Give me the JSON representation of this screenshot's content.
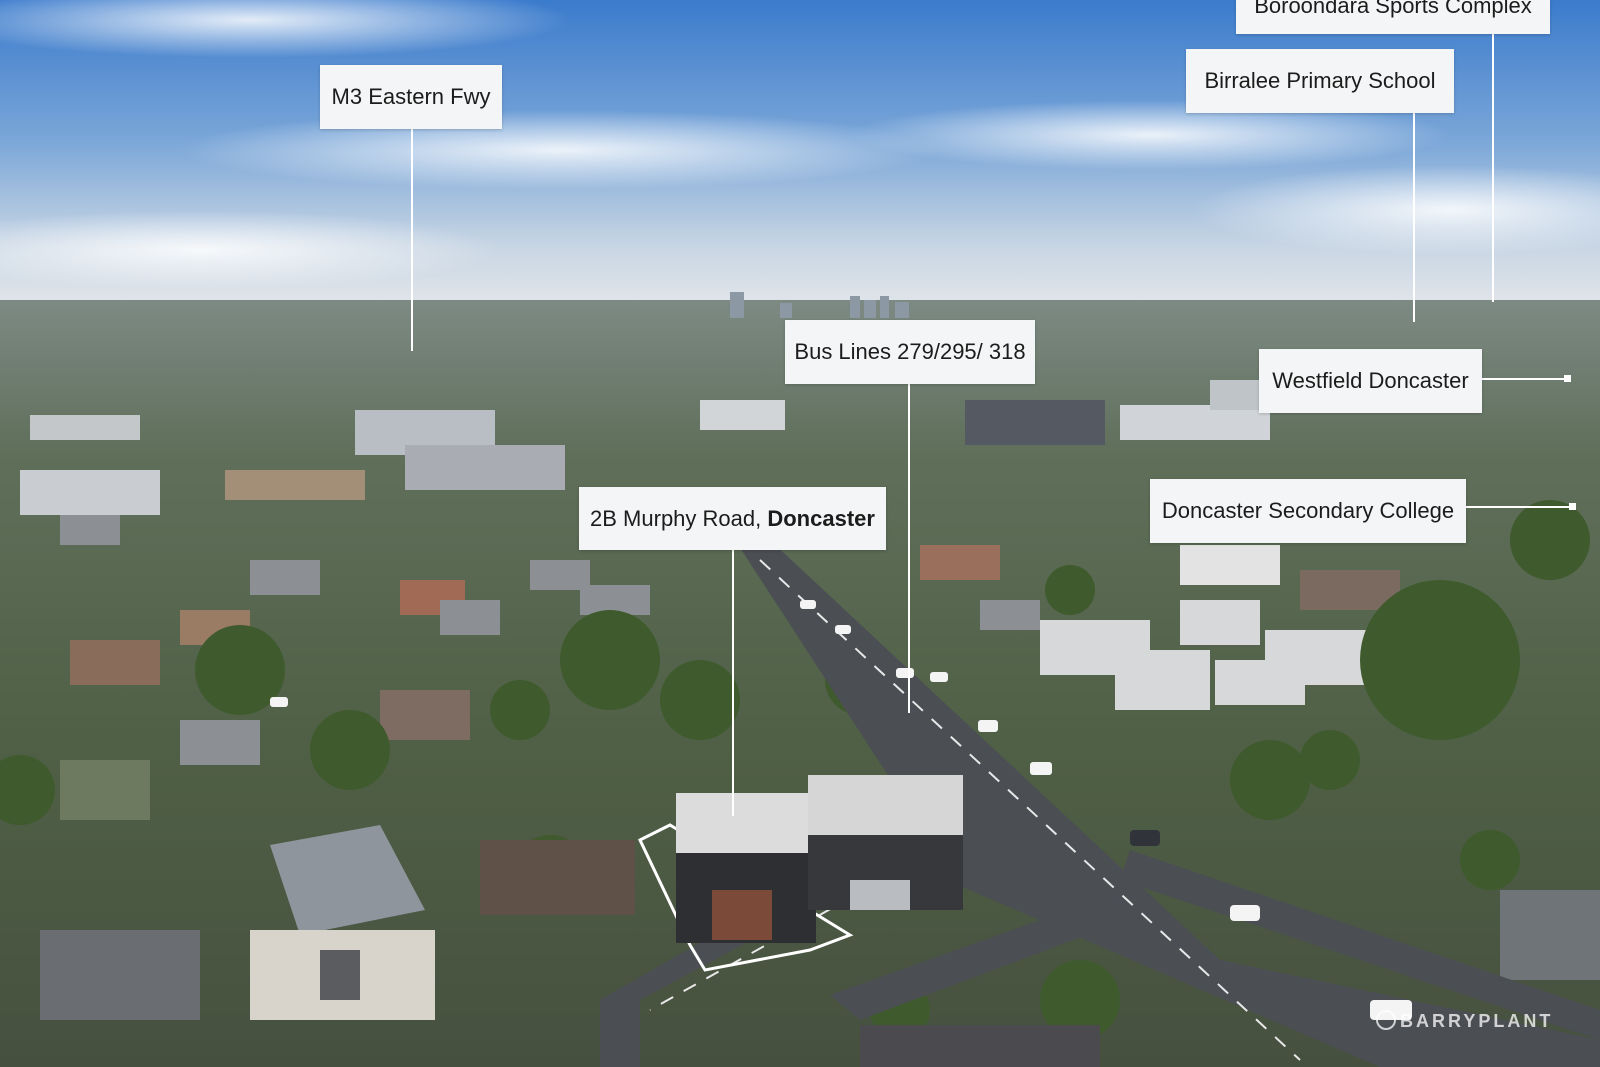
{
  "map": {
    "subject_property": {
      "label_prefix": "2B Murphy Road, ",
      "label_suffix": "Doncaster"
    },
    "callouts": [
      {
        "id": "boroondara",
        "label": "Boroondara Sports Complex"
      },
      {
        "id": "birralee",
        "label": "Birralee Primary School"
      },
      {
        "id": "m3",
        "label": "M3 Eastern Fwy"
      },
      {
        "id": "bus",
        "label": "Bus Lines 279/295/ 318"
      },
      {
        "id": "westfield",
        "label": "Westfield Doncaster"
      },
      {
        "id": "secondary",
        "label": "Doncaster Secondary College"
      }
    ],
    "watermark": "BARRYPLANT",
    "colors": {
      "callout_bg": "#f4f5f6",
      "callout_text": "#1c1c1c",
      "leader_line": "#ffffff",
      "sky_top": "#3d7ed0",
      "sky_horizon": "#dde3ea",
      "road": "#4a4d52",
      "vegetation": "#4e6a3a",
      "rooftops": "#8a8f96"
    }
  }
}
